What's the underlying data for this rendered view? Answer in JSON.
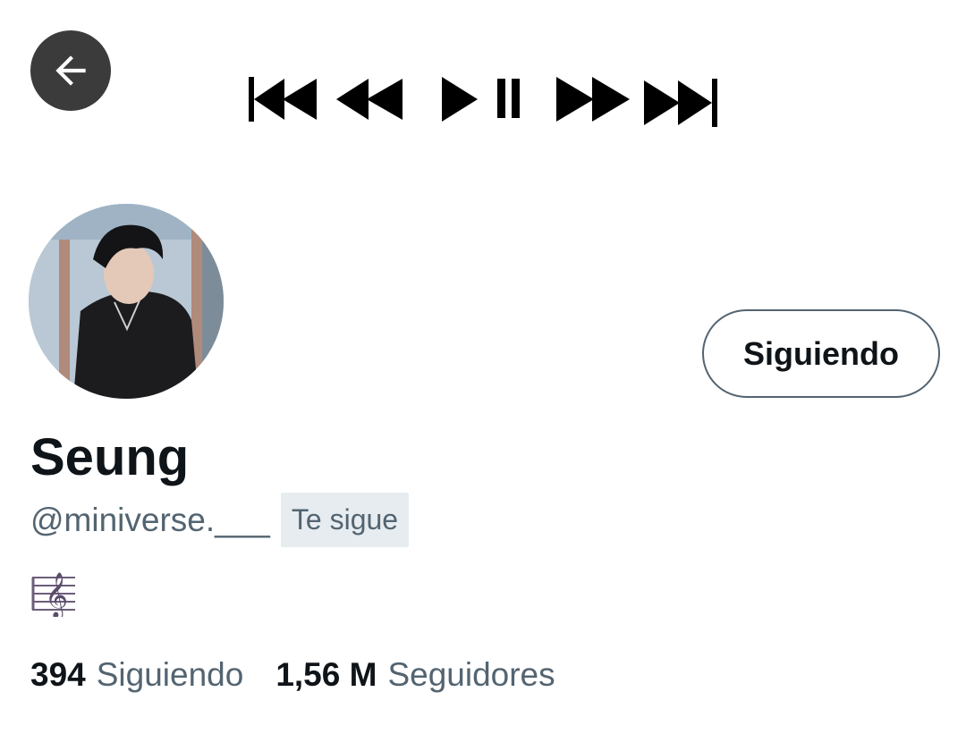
{
  "header": {
    "back_icon": "arrow-left-icon",
    "media_icons": [
      "skip-previous-icon",
      "rewind-icon",
      "play-pause-icon",
      "fast-forward-icon",
      "skip-next-icon"
    ]
  },
  "profile": {
    "display_name": "Seung",
    "handle": "@miniverse.___",
    "follows_you": "Te sigue",
    "bio_icon": "treble-clef-staff-icon",
    "follow_button": "Siguiendo"
  },
  "stats": {
    "following_count": "394",
    "following_label": "Siguiendo",
    "followers_count": "1,56 M",
    "followers_label": "Seguidores"
  },
  "colors": {
    "text_primary": "#0f1419",
    "text_secondary": "#536471",
    "back_button_bg": "#3b3b3b",
    "badge_bg": "#e7ecf0"
  }
}
